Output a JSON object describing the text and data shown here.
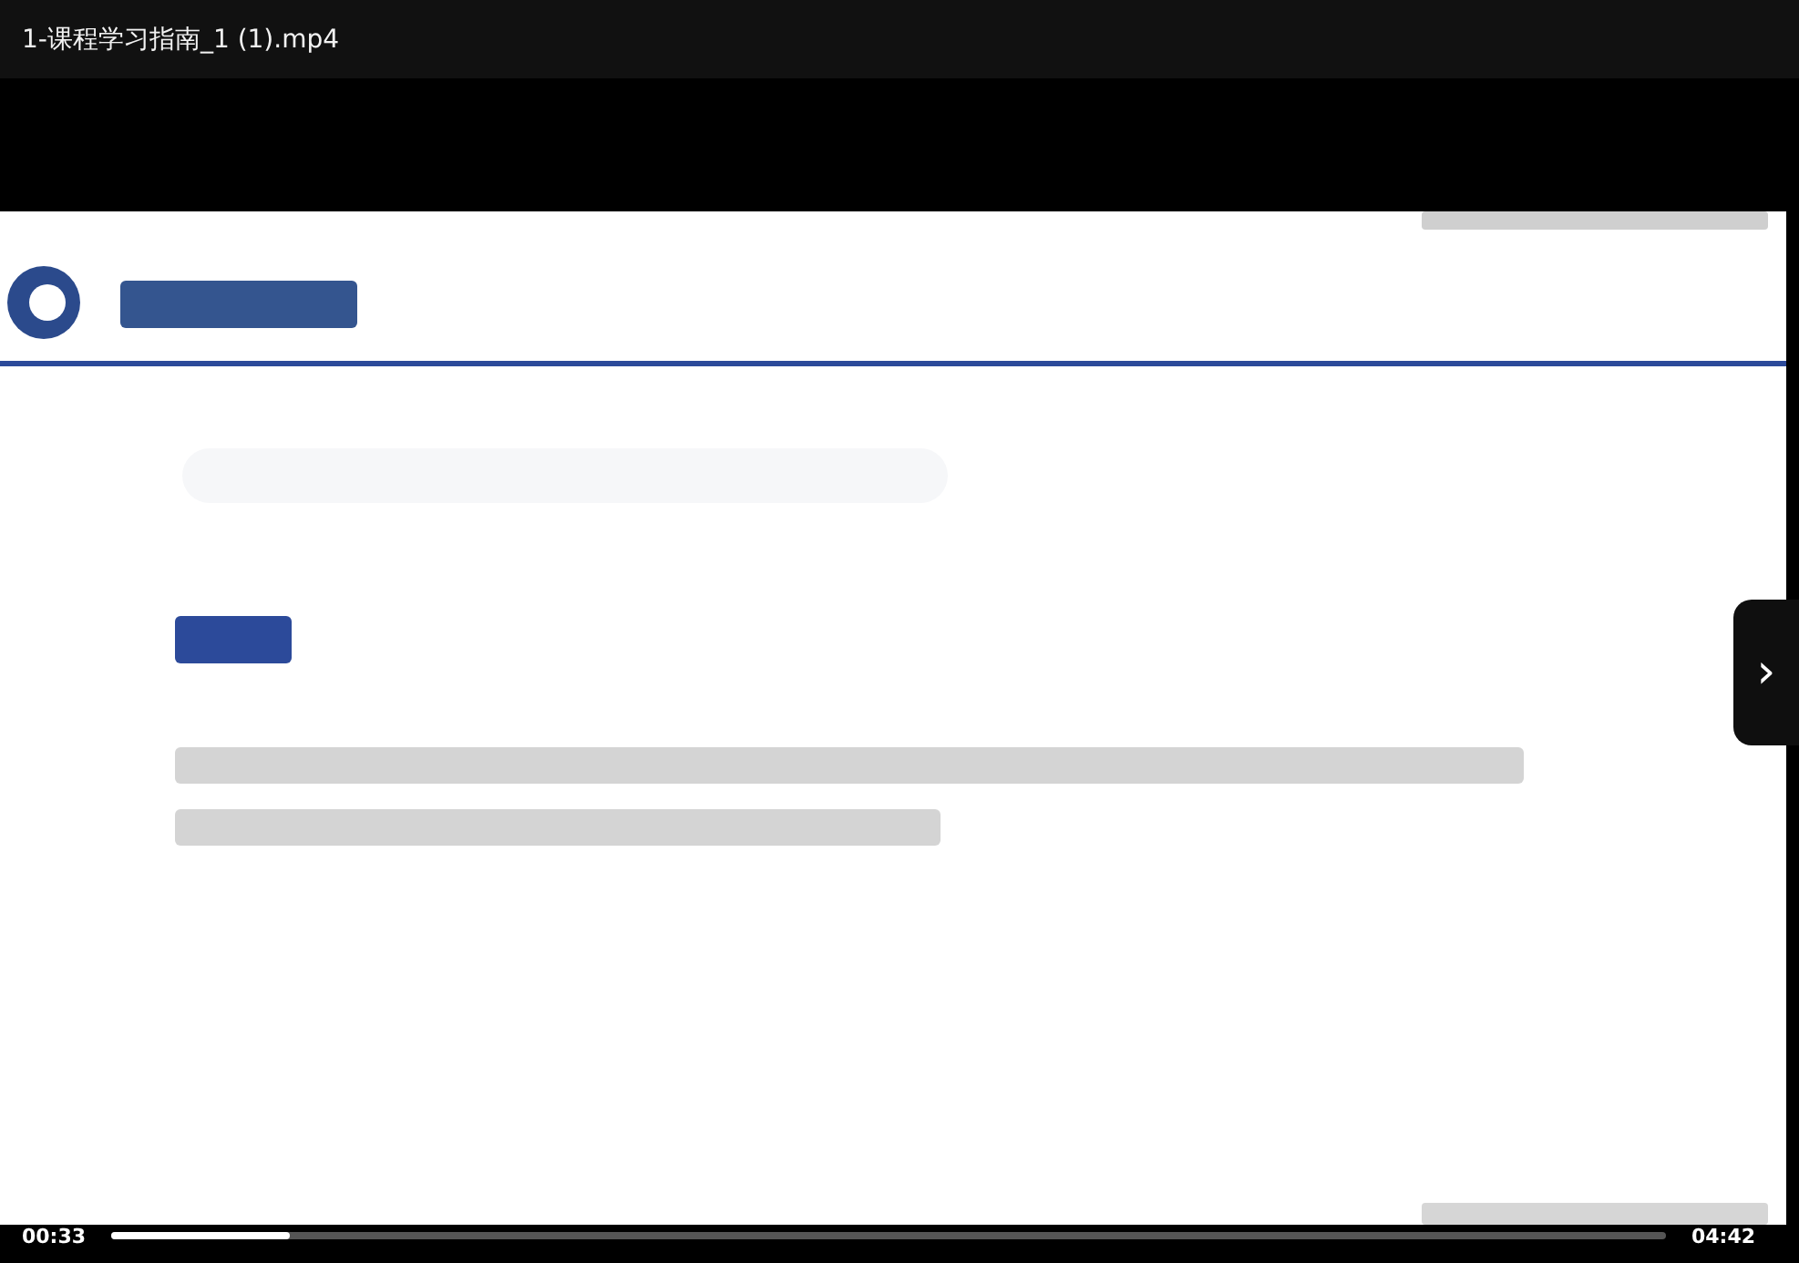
{
  "window": {
    "title": "1-课程学习指南_1 (1).mp4"
  },
  "next_button": {
    "icon": "›"
  },
  "playback": {
    "elapsed": "00:33",
    "duration": "04:42",
    "level": 0.115
  }
}
